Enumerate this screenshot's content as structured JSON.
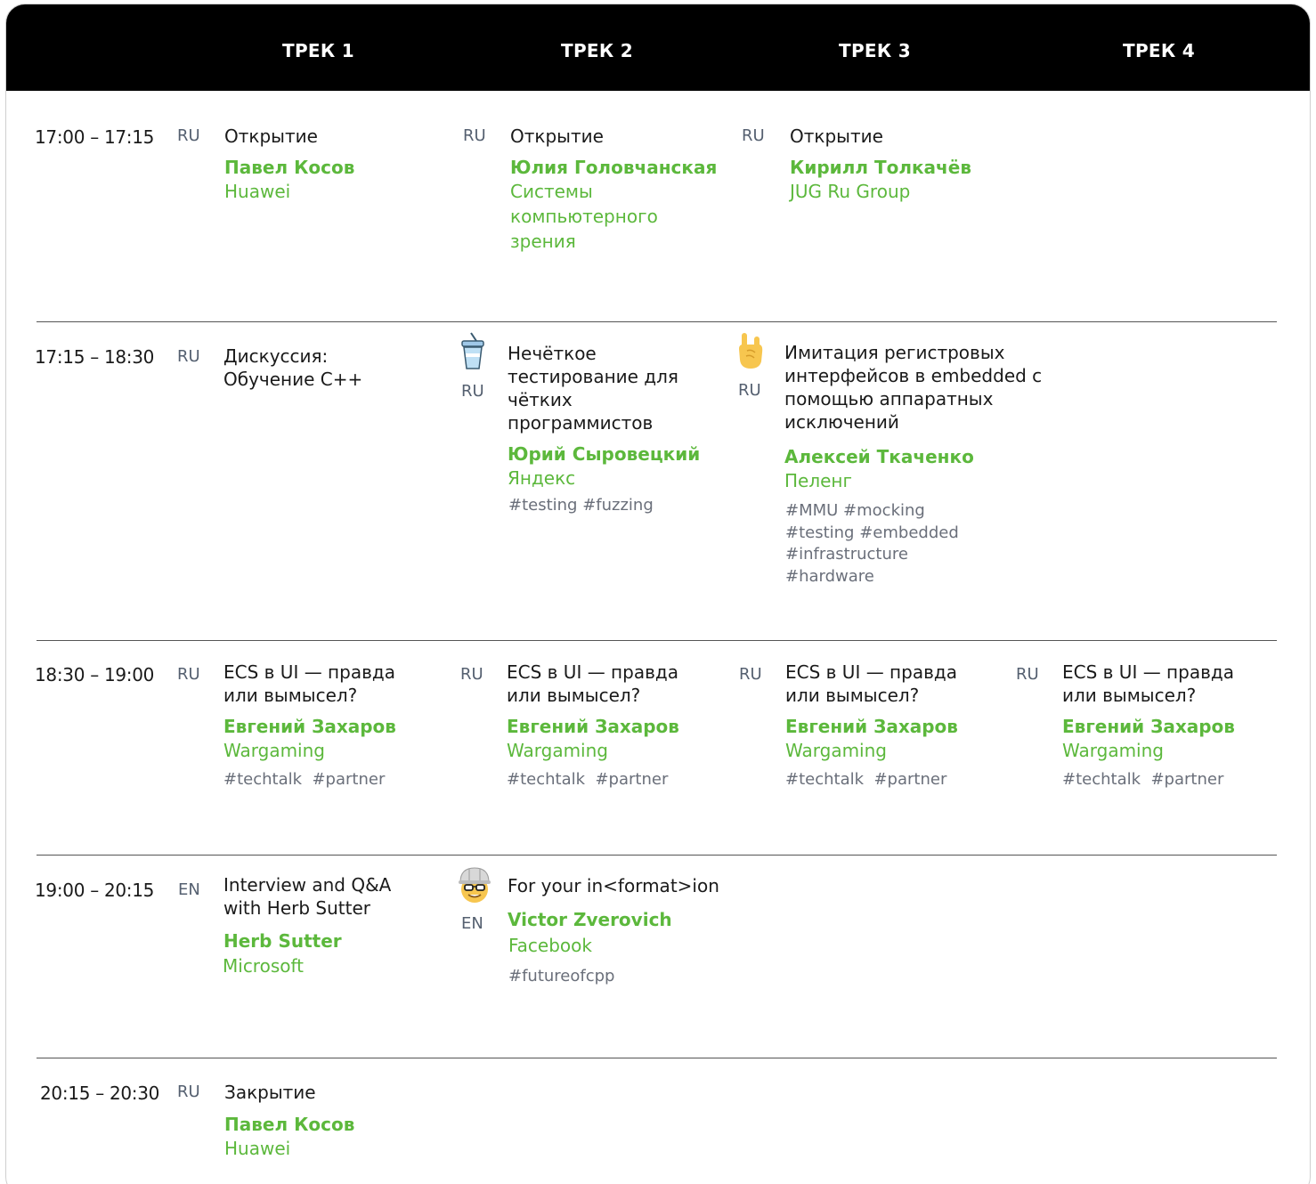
{
  "tracks": [
    "ТРЕК 1",
    "ТРЕК 2",
    "ТРЕК 3",
    "ТРЕК 4"
  ],
  "rows": [
    {
      "time": "17:00 – 17:15",
      "talks": [
        {
          "lang": "RU",
          "title": "Открытие",
          "speaker": "Павел Косов",
          "company": "Huawei",
          "tags": ""
        },
        {
          "lang": "RU",
          "title": "Открытие",
          "speaker": "Юлия Головчанская",
          "company": "Системы компьютерного зрения",
          "tags": ""
        },
        {
          "lang": "RU",
          "title": "Открытие",
          "speaker": "Кирилл Толкачёв",
          "company": "JUG Ru Group",
          "tags": ""
        }
      ]
    },
    {
      "time": "17:15 – 18:30",
      "talks": [
        {
          "lang": "RU",
          "title": "Дискуссия: Обучение C++",
          "speaker": "",
          "company": "",
          "tags": ""
        },
        {
          "lang": "RU",
          "icon": "drink-cup-icon",
          "title": "Нечёткое тестирование для чётких программистов",
          "speaker": "Юрий Сыровецкий",
          "company": "Яндекс",
          "tags": "#testing  #fuzzing"
        },
        {
          "lang": "RU",
          "icon": "rock-hand-icon",
          "title": "Имитация регистровых интерфейсов в embedded с помощью аппаратных исключений",
          "speaker": "Алексей Ткаченко",
          "company": "Пеленг",
          "tags": "#MMU #mocking #testing #embedded #infrastructure #hardware"
        }
      ]
    },
    {
      "time": "18:30 – 19:00",
      "talks": [
        {
          "lang": "RU",
          "title": "ECS в UI — правда или вымысел?",
          "speaker": "Евгений Захаров",
          "company": "Wargaming",
          "tags": "#techtalk  #partner"
        },
        {
          "lang": "RU",
          "title": "ECS в UI — правда или вымысел?",
          "speaker": "Евгений Захаров",
          "company": "Wargaming",
          "tags": "#techtalk  #partner"
        },
        {
          "lang": "RU",
          "title": "ECS в UI — правда или вымысел?",
          "speaker": "Евгений Захаров",
          "company": "Wargaming",
          "tags": "#techtalk  #partner"
        },
        {
          "lang": "RU",
          "title": "ECS в UI — правда или вымысел?",
          "speaker": "Евгений Захаров",
          "company": "Wargaming",
          "tags": "#techtalk  #partner"
        }
      ]
    },
    {
      "time": "19:00 – 20:15",
      "talks": [
        {
          "lang": "EN",
          "title": "Interview and Q&A with Herb Sutter",
          "speaker": "Herb Sutter",
          "company": "Microsoft",
          "tags": ""
        },
        {
          "lang": "EN",
          "icon": "nerd-helmet-icon",
          "title": "For your in<format>ion",
          "speaker": "Victor Zverovich",
          "company": "Facebook",
          "tags": "#futureofcpp"
        }
      ]
    },
    {
      "time": "20:15 – 20:30",
      "talks": [
        {
          "lang": "RU",
          "title": "Закрытие",
          "speaker": "Павел Косов",
          "company": "Huawei",
          "tags": ""
        }
      ]
    }
  ]
}
